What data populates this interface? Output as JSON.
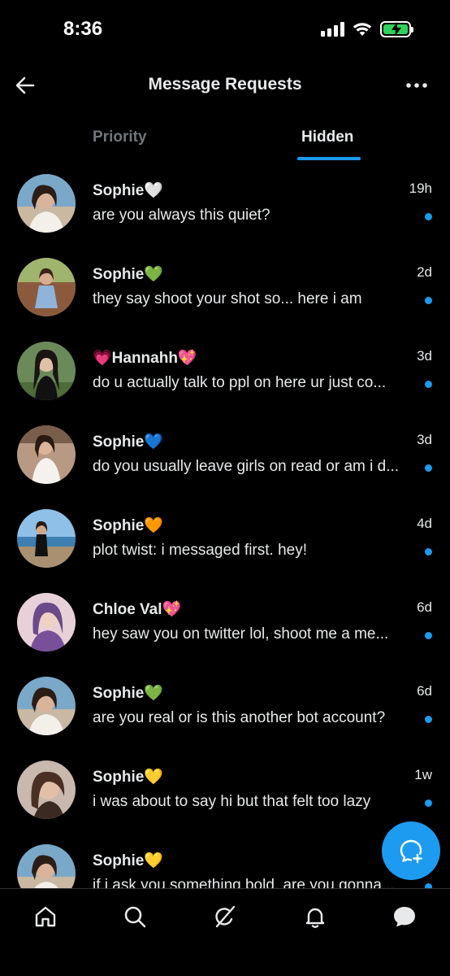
{
  "status_bar": {
    "time": "8:36",
    "battery_level": 1.0,
    "battery_color": "#30d158"
  },
  "header": {
    "title": "Message Requests",
    "back_icon": "arrow-left-icon",
    "more_icon": "ellipsis-icon"
  },
  "tabs": [
    {
      "label": "Priority",
      "selected": false
    },
    {
      "label": "Hidden",
      "selected": true
    }
  ],
  "accent_color": "#1d9bf0",
  "conversations": [
    {
      "name": "Sophie🤍",
      "time": "19h",
      "preview": "are you always this quiet?",
      "unread": true
    },
    {
      "name": "Sophie💚",
      "time": "2d",
      "preview": "they say shoot your shot so... here i am",
      "unread": true
    },
    {
      "name": "💗Hannahh💖",
      "time": "3d",
      "preview": "do u actually talk to ppl on here ur just co...",
      "unread": true
    },
    {
      "name": "Sophie💙",
      "time": "3d",
      "preview": "do you usually leave girls on read or am i d...",
      "unread": true
    },
    {
      "name": "Sophie🧡",
      "time": "4d",
      "preview": "plot twist: i messaged first. hey!",
      "unread": true
    },
    {
      "name": "Chloe Val💖",
      "time": "6d",
      "preview": "hey saw you on twitter lol, shoot me a me...",
      "unread": true
    },
    {
      "name": "Sophie💚",
      "time": "6d",
      "preview": "are you real or is this another bot account?",
      "unread": true
    },
    {
      "name": "Sophie💛",
      "time": "1w",
      "preview": "i was about to say hi but that felt too lazy",
      "unread": true
    },
    {
      "name": "Sophie💛",
      "time": "",
      "preview": "if i ask you something bold, are you gonna...",
      "unread": true
    }
  ],
  "fab": {
    "icon": "new-message-icon"
  },
  "bottom_nav": [
    {
      "icon": "home-icon"
    },
    {
      "icon": "search-icon"
    },
    {
      "icon": "grok-icon"
    },
    {
      "icon": "bell-icon"
    },
    {
      "icon": "messages-icon",
      "active": true
    }
  ]
}
